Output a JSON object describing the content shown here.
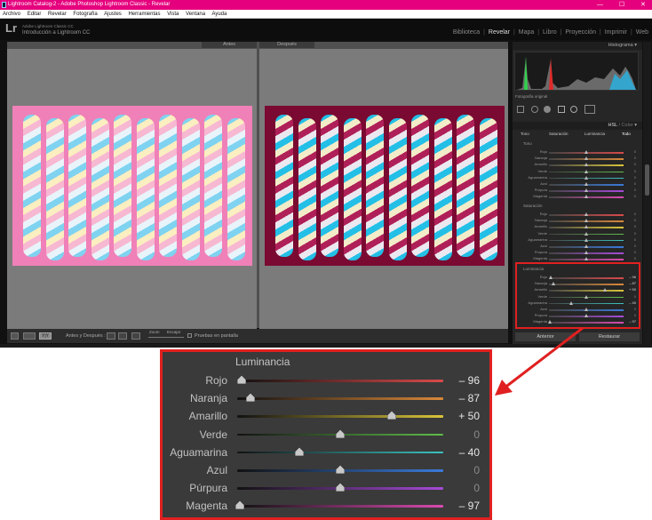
{
  "window": {
    "title": "Lightroom Catalog-2 - Adobe Photoshop Lightroom Classic - Revelar",
    "controls": [
      "—",
      "☐",
      "✕"
    ]
  },
  "menu": [
    "Archivo",
    "Editar",
    "Revelar",
    "Fotografía",
    "Ajustes",
    "Herramientas",
    "Vista",
    "Ventana",
    "Ayuda"
  ],
  "identity": {
    "logo": "Lr",
    "line1": "Adobe Lightroom Classic CC",
    "line2": "Introducción a Lightroom CC"
  },
  "modules": {
    "items": [
      "Biblioteca",
      "Revelar",
      "Mapa",
      "Libro",
      "Proyección",
      "Imprimir",
      "Web"
    ],
    "active": "Revelar"
  },
  "view": {
    "before_label": "Antes",
    "after_label": "Después"
  },
  "toolbar": {
    "before_after_label": "Antes y Después :",
    "zoom_label": "Zoom",
    "fit_label": "Encajar",
    "proof_label": "Pruebas en pantalla"
  },
  "panels": {
    "histogram_title": "Histograma",
    "original_photo": "Fotografía original",
    "hsl_title_active": "HSL",
    "hsl_title_rest": "/ Color",
    "tabs": [
      "Tono",
      "Saturación",
      "Luminancia",
      "Todo"
    ],
    "section_tono": "Tono",
    "section_saturacion": "Saturación",
    "section_luminancia": "Luminancia",
    "buttons": {
      "previous": "Anterior",
      "reset": "Restaurar"
    }
  },
  "colors": {
    "title_bar": "#e5007d",
    "highlight": "#e02020",
    "panel_bg": "#262626",
    "zoom_panel_bg": "#3a3a3a"
  },
  "hsl": {
    "channels": [
      "Rojo",
      "Naranja",
      "Amarillo",
      "Verde",
      "Aguamarina",
      "Azul",
      "Púrpura",
      "Magenta"
    ],
    "tono_values": [
      "0",
      "0",
      "0",
      "0",
      "0",
      "0",
      "0",
      "0"
    ],
    "saturacion_values": [
      "0",
      "0",
      "0",
      "0",
      "0",
      "0",
      "0",
      "0"
    ],
    "luminancia_values": [
      "– 96",
      "– 87",
      "+ 50",
      "0",
      "– 40",
      "0",
      "0",
      "– 97"
    ],
    "luminancia_numeric": [
      -96,
      -87,
      50,
      0,
      -40,
      0,
      0,
      -97
    ],
    "track_colors": [
      "#d94a4a",
      "#d9883a",
      "#d9c43a",
      "#5fbf4a",
      "#3ac4c0",
      "#3a7ad9",
      "#a64ad9",
      "#d94ab0"
    ]
  },
  "zoom_panel": {
    "title": "Luminancia"
  }
}
